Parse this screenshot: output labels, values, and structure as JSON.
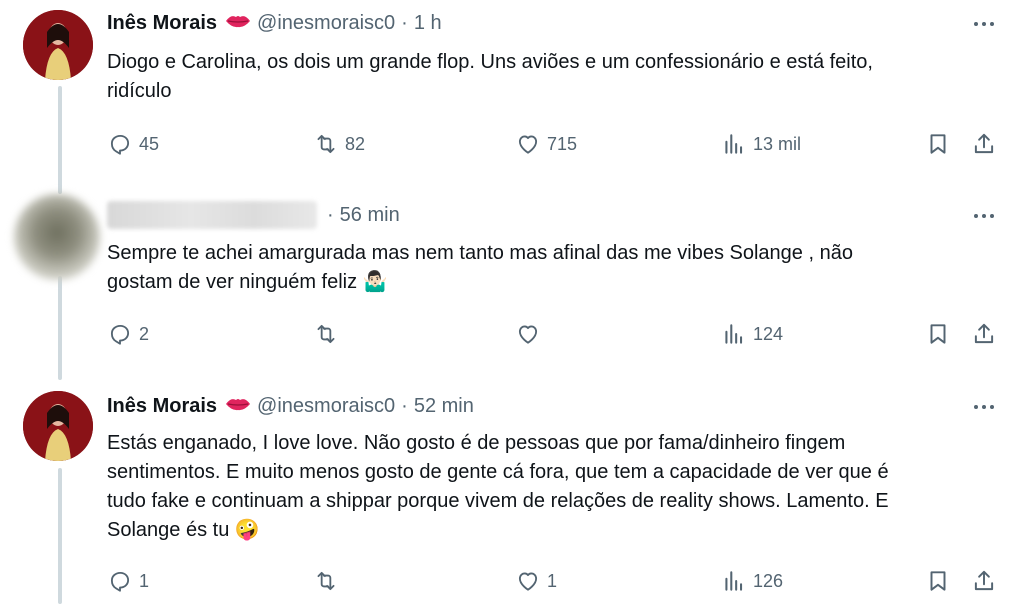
{
  "tweets": [
    {
      "name": "Inês Morais",
      "handle": "@inesmoraisc0",
      "time": "1 h",
      "text_lines": [
        "Diogo e Carolina, os dois um grande flop. Uns aviões e um confessionário e está feito,",
        "ridículo"
      ],
      "replies": "45",
      "retweets": "82",
      "likes": "715",
      "views": "13 mil"
    },
    {
      "name": "",
      "handle": "",
      "time": "56 min",
      "text_lines": [
        "Sempre te achei amargurada mas nem tanto mas afinal das me vibes Solange , não",
        "gostam de ver ninguém feliz 🤷🏻‍♂️"
      ],
      "replies": "2",
      "retweets": "",
      "likes": "",
      "views": "124"
    },
    {
      "name": "Inês Morais",
      "handle": "@inesmoraisc0",
      "time": "52 min",
      "text_lines": [
        "Estás enganado, I love love. Não gosto é de pessoas que por fama/dinheiro fingem",
        "sentimentos. E muito menos gosto de gente cá fora, que tem a capacidade de ver que é",
        "tudo fake e continuam a shippar porque vivem de relações de reality shows. Lamento. E",
        "Solange és tu 🤪"
      ],
      "replies": "1",
      "retweets": "",
      "likes": "1",
      "views": "126"
    }
  ],
  "colors": {
    "text": "#0f1419",
    "muted": "#536471",
    "thread": "#cfd9de",
    "lips": "#e0245e"
  },
  "icons": [
    "lips-emoji-icon",
    "more-icon",
    "reply-icon",
    "retweet-icon",
    "like-icon",
    "views-icon",
    "bookmark-icon",
    "share-icon"
  ]
}
